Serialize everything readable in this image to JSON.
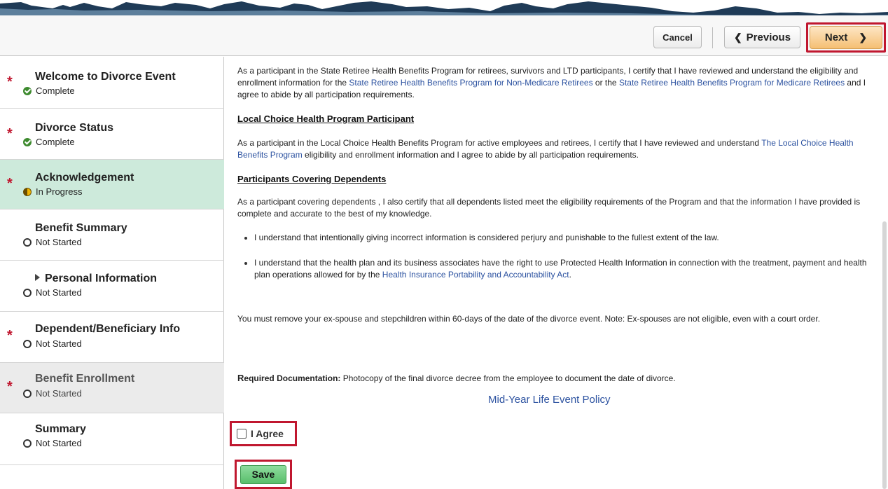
{
  "toolbar": {
    "cancel_label": "Cancel",
    "previous_label": "Previous",
    "next_label": "Next"
  },
  "steps": [
    {
      "title": "Welcome to Divorce Event",
      "status": "Complete",
      "required": true
    },
    {
      "title": "Divorce Status",
      "status": "Complete",
      "required": true
    },
    {
      "title": "Acknowledgement",
      "status": "In Progress",
      "required": true
    },
    {
      "title": "Benefit Summary",
      "status": "Not Started",
      "required": false
    },
    {
      "title": "Personal Information",
      "status": "Not Started",
      "required": false
    },
    {
      "title": "Dependent/Beneficiary Info",
      "status": "Not Started",
      "required": true
    },
    {
      "title": "Benefit Enrollment",
      "status": "Not Started",
      "required": true
    },
    {
      "title": "Summary",
      "status": "Not Started",
      "required": false
    }
  ],
  "required_marker": "*",
  "content": {
    "intro_text_1": "As a participant in the State Retiree Health Benefits Program for retirees, survivors and LTD participants, I certify that I have reviewed and understand the eligibility and enrollment information for the ",
    "intro_link_1": "State Retiree Health Benefits Program for Non-Medicare Retirees",
    "intro_text_2": " or the ",
    "intro_link_2": "State Retiree Health Benefits Program for Medicare Retirees",
    "intro_text_3": " and I agree to abide by all participation requirements.",
    "local_choice_heading": "Local Choice Health Program Participant",
    "local_choice_text_1": " As a participant in the Local Choice Health Benefits Program for active employees and retirees, I certify that I have reviewed and understand ",
    "local_choice_link": "The Local Choice Health Benefits Program",
    "local_choice_text_2": " eligibility and enrollment information and I agree to abide by all participation requirements.",
    "dependents_heading": "Participants Covering Dependents",
    "dependents_text": "As a participant covering dependents , I also certify that all dependents listed meet the eligibility requirements of the Program and that the information I have provided is complete and accurate to the best of my knowledge.",
    "bullet_1": "I understand that intentionally giving incorrect information is considered perjury and punishable to the fullest extent of the law.",
    "bullet_2_text": "I understand that the health plan and its business associates have the right to use Protected Health Information in connection with the treatment, payment and health plan operations allowed for by the ",
    "bullet_2_link": "Health Insurance Portability and Accountability Act",
    "bullet_2_end": ".",
    "remove_text": "You must remove your ex-spouse and stepchildren within 60-days of the date of the divorce event. Note: Ex-spouses are not eligible, even with a court order.",
    "req_doc_first_letter": "R",
    "req_doc_label_rest": "equired Documentation:",
    "req_doc_text": " Photocopy of the final divorce decree from the employee to document the date of divorce.",
    "policy_link": "Mid-Year Life Event Policy",
    "agree_label": "I Agree",
    "save_label": "Save"
  },
  "colors": {
    "active_step_bg": "#cdeadb",
    "disabled_step_bg": "#ebebeb",
    "required_star": "#c0172f",
    "highlight_border": "#c0172f",
    "next_button": "#f5bf73",
    "save_button": "#58be6b",
    "link": "#2c52a0"
  },
  "icons": {
    "complete": "check-circle-icon",
    "in_progress": "half-circle-icon",
    "not_started": "empty-circle-icon",
    "expand": "triangle-right-icon",
    "previous": "chevron-left-icon",
    "next": "chevron-right-icon"
  }
}
